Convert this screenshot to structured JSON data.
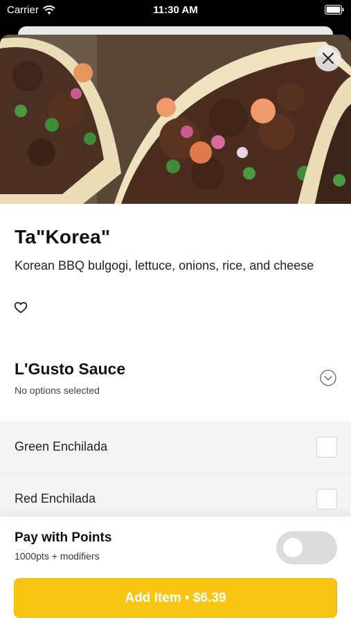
{
  "status": {
    "carrier": "Carrier",
    "time": "11:30 AM"
  },
  "item": {
    "title": "Ta\"Korea\"",
    "description": "Korean BBQ bulgogi, lettuce, onions, rice, and cheese"
  },
  "modifier_group": {
    "title": "L'Gusto Sauce",
    "subtitle": "No options selected",
    "options": [
      {
        "label": "Green Enchilada",
        "checked": false
      },
      {
        "label": "Red Enchilada",
        "checked": false
      }
    ]
  },
  "points": {
    "title": "Pay with Points",
    "subtitle": "1000pts + modifiers",
    "enabled": false
  },
  "cta": {
    "label": "Add Item • $6.39"
  },
  "colors": {
    "accent": "#f7c512"
  },
  "icons": [
    "wifi-icon",
    "battery-icon",
    "close-icon",
    "heart-outline-icon",
    "chevron-down-circle-icon"
  ]
}
